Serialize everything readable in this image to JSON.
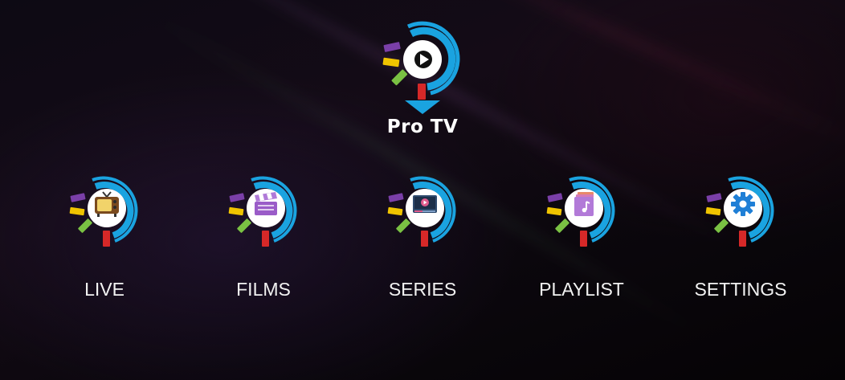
{
  "app": {
    "name": "Pro TV",
    "logo_icon": "play-icon"
  },
  "menu": [
    {
      "label": "LIVE",
      "icon": "tv-icon"
    },
    {
      "label": "FILMS",
      "icon": "clapperboard-icon"
    },
    {
      "label": "SERIES",
      "icon": "video-player-icon"
    },
    {
      "label": "PLAYLIST",
      "icon": "music-playlist-icon"
    },
    {
      "label": "SETTINGS",
      "icon": "gear-icon"
    }
  ],
  "colors": {
    "ring": "#1aa3e0",
    "bar_purple": "#7a3fa8",
    "bar_yellow": "#f0c400",
    "bar_green": "#7ac143",
    "bar_red": "#d62828",
    "label": "#f2f2f2"
  }
}
